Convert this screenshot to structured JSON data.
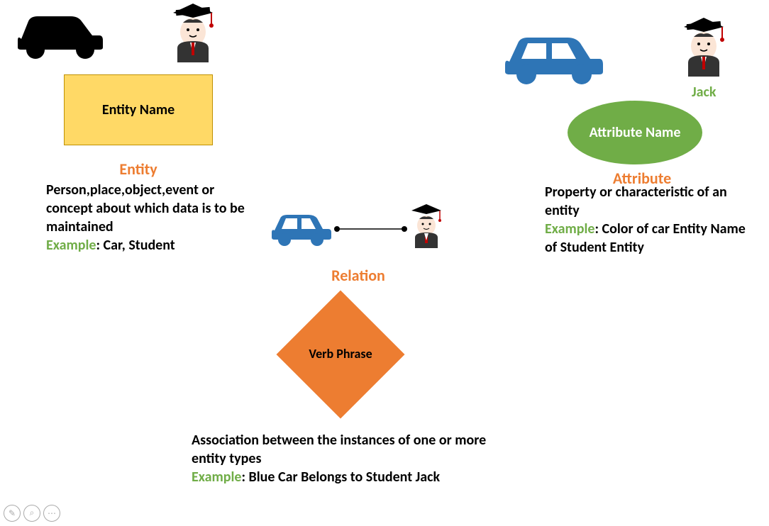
{
  "entity": {
    "box_label": "Entity Name",
    "title": "Entity",
    "desc": "Person,place,object,event or concept about which data is to be maintained",
    "example_label": "Example",
    "example_text": ": Car, Student"
  },
  "attribute": {
    "jack": "Jack",
    "ellipse_label": "Attribute Name",
    "title": "Attribute",
    "desc": "Property or characteristic of an entity",
    "example_label": "Example",
    "example_text": ": Color of car Entity Name of Student Entity"
  },
  "relation": {
    "title": "Relation",
    "diamond_label": "Verb Phrase",
    "desc": "Association between the instances of one or more entity types",
    "example_label": "Example",
    "example_text": ": Blue Car Belongs to Student Jack"
  }
}
